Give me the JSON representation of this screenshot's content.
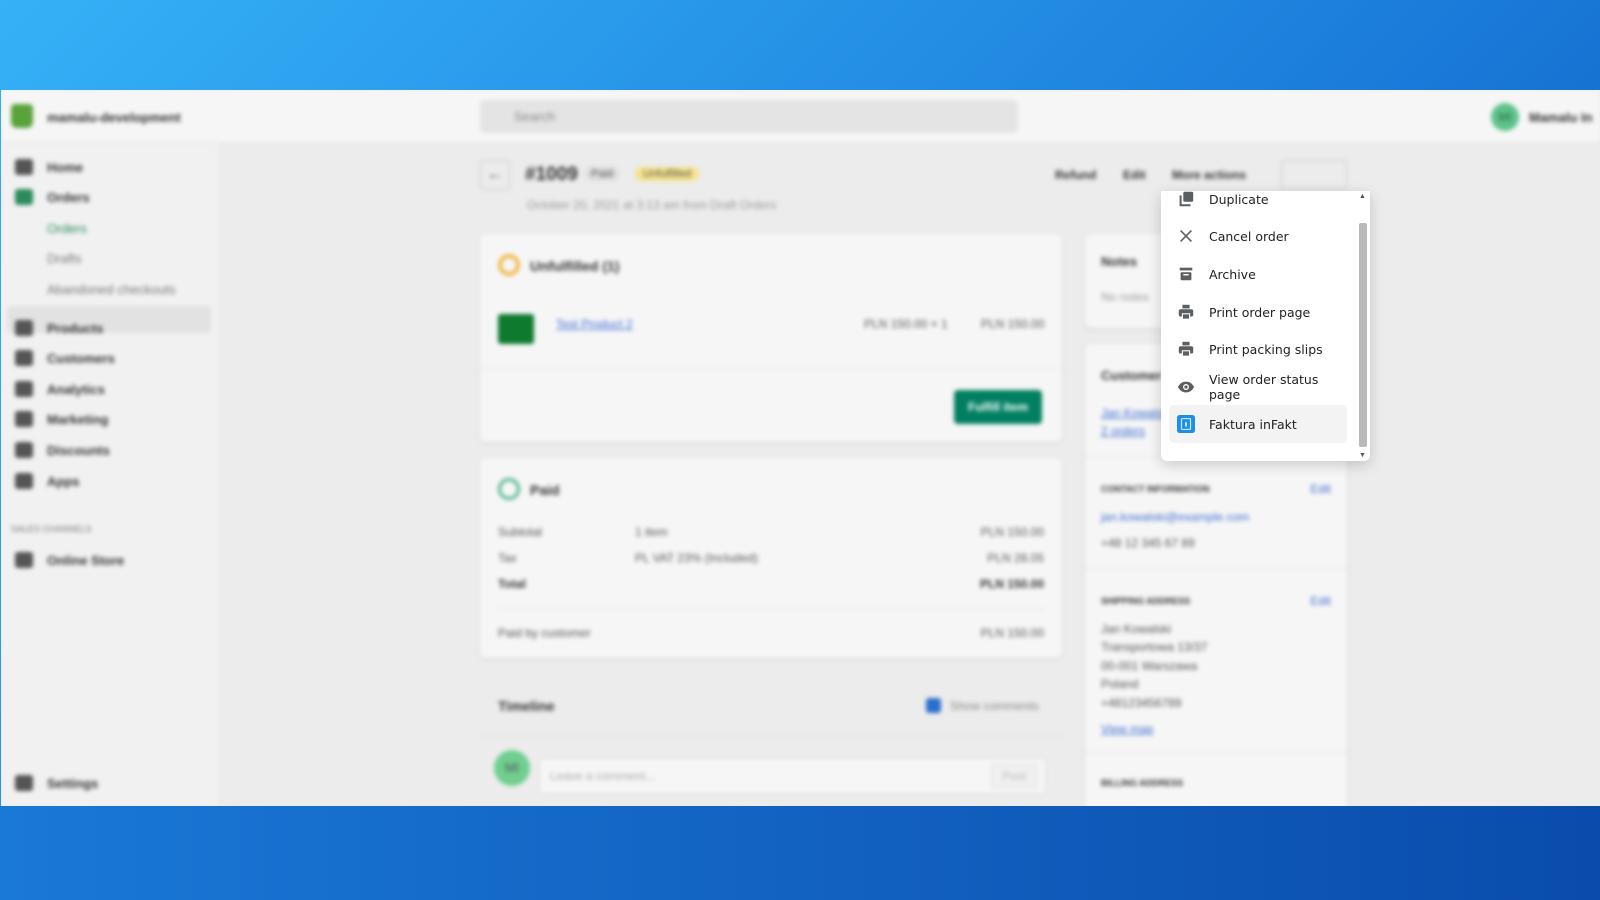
{
  "topbar": {
    "store": "mamalu-development",
    "search_placeholder": "Search",
    "avatar_initials": "MI",
    "user": "Mamalu In"
  },
  "sidebar": {
    "items": [
      "Home",
      "Orders",
      "Products",
      "Customers",
      "Analytics",
      "Marketing",
      "Discounts",
      "Apps"
    ],
    "orders_sub": [
      "Orders",
      "Drafts",
      "Abandoned checkouts"
    ],
    "sales_channels": "SALES CHANNELS",
    "online_store": "Online Store",
    "settings": "Settings"
  },
  "order": {
    "number": "#1009",
    "paid_badge": "Paid",
    "unfulfilled_badge": "Unfulfilled",
    "subtitle": "October 20, 2021 at 3:13 am from Draft Orders",
    "actions": [
      "Refund",
      "Edit",
      "More actions"
    ]
  },
  "unfulfilled": {
    "title": "Unfulfilled (1)",
    "product": "Test Product 2",
    "qty_price": "PLN 150.00 × 1",
    "total": "PLN 150.00",
    "button": "Fulfill item"
  },
  "paid": {
    "title": "Paid",
    "rows": [
      {
        "label": "Subtotal",
        "desc": "1 item",
        "value": "PLN 150.00"
      },
      {
        "label": "Tax",
        "desc": "PL VAT 23% (Included)",
        "value": "PLN 28.05"
      },
      {
        "label": "Total",
        "desc": "",
        "value": "PLN 150.00"
      }
    ],
    "paid_by_label": "Paid by customer",
    "paid_by_value": "PLN 150.00"
  },
  "timeline": {
    "title": "Timeline",
    "show_comments": "Show comments",
    "comment_placeholder": "Leave a comment...",
    "post": "Post",
    "avatar": "MI"
  },
  "notes": {
    "title": "Notes",
    "empty": "No notes"
  },
  "customer": {
    "title": "Customer",
    "name": "Jan Kowalski",
    "orders": "2 orders",
    "contact_title": "CONTACT INFORMATION",
    "edit": "Edit",
    "email": "jan.kowalski@example.com",
    "phone": "+48 12 345 67 89",
    "shipping_title": "SHIPPING ADDRESS",
    "address": [
      "Jan Kowalski",
      "Transportowa 13/37",
      "00-001 Warszawa",
      "Poland",
      "+48123456789"
    ],
    "view_map": "View map",
    "billing_title": "BILLING ADDRESS"
  },
  "menu": {
    "items": [
      {
        "label": "Duplicate",
        "icon": "duplicate-icon"
      },
      {
        "label": "Cancel order",
        "icon": "close-icon"
      },
      {
        "label": "Archive",
        "icon": "archive-icon"
      },
      {
        "label": "Print order page",
        "icon": "printer-icon"
      },
      {
        "label": "Print packing slips",
        "icon": "printer-icon"
      },
      {
        "label": "View order status page",
        "icon": "eye-icon"
      },
      {
        "label": "Faktura inFakt",
        "icon": "infakt-app-icon",
        "highlighted": true
      }
    ]
  },
  "colors": {
    "accent": "#008060",
    "infakt": "#1e8ff0"
  }
}
